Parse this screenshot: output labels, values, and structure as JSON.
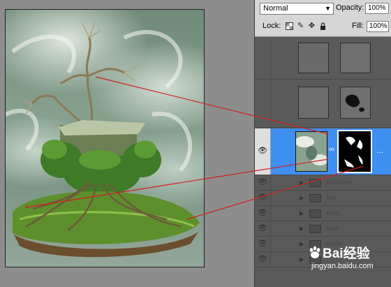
{
  "layers_panel": {
    "blend_mode": "Normal",
    "opacity_label": "Opacity:",
    "opacity_value": "100%",
    "lock_label": "Lock:",
    "fill_label": "Fill:",
    "fill_value": "100%",
    "layer_options_glyph": "...",
    "group_names": [
      "Branches",
      "tree",
      "roots",
      "cave",
      "island"
    ]
  },
  "watermark": {
    "logo": "Bai经验",
    "url": "jingyan.baidu.com"
  },
  "colors": {
    "selected_layer": "#3e8ff0",
    "guide_lines": "#d42020"
  }
}
